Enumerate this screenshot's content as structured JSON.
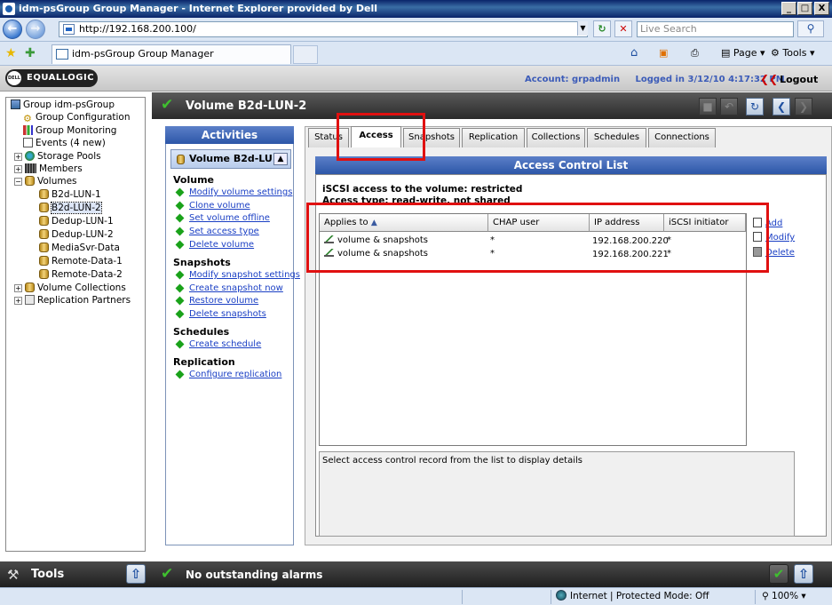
{
  "window": {
    "title": "idm-psGroup Group Manager - Internet Explorer provided by Dell",
    "min": "_",
    "max": "□",
    "close": "X"
  },
  "browser": {
    "url": "http://192.168.200.100/",
    "search_placeholder": "Live Search",
    "tab_title": "idm-psGroup Group Manager",
    "toolbar": {
      "page": "Page",
      "tools": "Tools"
    },
    "status_zone": "Internet | Protected Mode: Off",
    "zoom": "100%"
  },
  "app": {
    "logo": "EQUALLOGIC",
    "logo_badge": "DELL",
    "account": "Account: grpadmin",
    "logged_in": "Logged in 3/12/10 4:17:32 PM",
    "logout": "Logout"
  },
  "tree": {
    "items": [
      {
        "label": "Group idm-psGroup"
      },
      {
        "label": "Group Configuration"
      },
      {
        "label": "Group Monitoring"
      },
      {
        "label": "Events (4 new)"
      },
      {
        "label": "Storage Pools"
      },
      {
        "label": "Members"
      },
      {
        "label": "Volumes"
      },
      {
        "label": "B2d-LUN-1"
      },
      {
        "label": "B2d-LUN-2"
      },
      {
        "label": "Dedup-LUN-1"
      },
      {
        "label": "Dedup-LUN-2"
      },
      {
        "label": "MediaSvr-Data"
      },
      {
        "label": "Remote-Data-1"
      },
      {
        "label": "Remote-Data-2"
      },
      {
        "label": "Volume Collections"
      },
      {
        "label": "Replication Partners"
      }
    ]
  },
  "tools_label": "Tools",
  "volume": {
    "title": "Volume B2d-LUN-2"
  },
  "activities": {
    "title": "Activities",
    "selected": "Volume B2d-LU...",
    "sections": [
      {
        "title": "Volume",
        "links": [
          "Modify volume settings",
          "Clone volume",
          "Set volume offline",
          "Set access type",
          "Delete volume"
        ]
      },
      {
        "title": "Snapshots",
        "links": [
          "Modify snapshot settings",
          "Create snapshot now",
          "Restore volume",
          "Delete snapshots"
        ]
      },
      {
        "title": "Schedules",
        "links": [
          "Create schedule"
        ]
      },
      {
        "title": "Replication",
        "links": [
          "Configure replication"
        ]
      }
    ]
  },
  "tabs": [
    "Status",
    "Access",
    "Snapshots",
    "Replication",
    "Collections",
    "Schedules",
    "Connections"
  ],
  "acl": {
    "title": "Access Control List",
    "iscsi_access": "iSCSI access to the volume: restricted",
    "access_type": "Access type: read-write, not shared",
    "columns": [
      "Applies to",
      "CHAP user",
      "IP address",
      "iSCSI initiator"
    ],
    "rows": [
      {
        "applies": "volume & snapshots",
        "chap": "*",
        "ip": "192.168.200.220",
        "initiator": "*"
      },
      {
        "applies": "volume & snapshots",
        "chap": "*",
        "ip": "192.168.200.221",
        "initiator": "*"
      }
    ],
    "actions": [
      "Add",
      "Modify",
      "Delete"
    ],
    "details_hint": "Select access control record from the list to display details"
  },
  "alarms": "No outstanding alarms",
  "colors": {
    "highlight": "#e01010",
    "header_blue": "#2c56a8",
    "link": "#1a3fc4"
  }
}
